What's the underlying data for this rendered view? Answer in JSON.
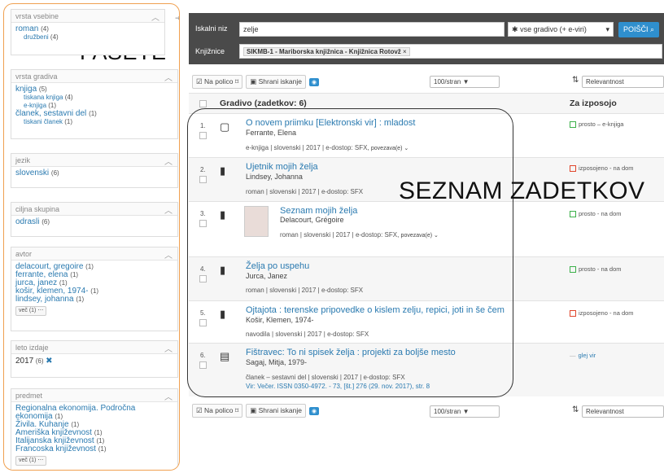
{
  "sidebar": {
    "label": "FASETE",
    "facets": [
      {
        "title": "vrsta vsebine",
        "items": [
          {
            "label": "roman",
            "count": "(4)"
          },
          {
            "label": "družbeni",
            "count": "(4)",
            "sub": true
          }
        ]
      },
      {
        "title": "vrsta gradiva",
        "items": [
          {
            "label": "knjiga",
            "count": "(5)"
          },
          {
            "label": "tiskana knjiga",
            "count": "(4)",
            "sub": true
          },
          {
            "label": "e-knjiga",
            "count": "(1)",
            "sub": true
          },
          {
            "label": "članek, sestavni del",
            "count": "(1)"
          },
          {
            "label": "tiskani članek",
            "count": "(1)",
            "sub": true
          }
        ]
      },
      {
        "title": "jezik",
        "items": [
          {
            "label": "slovenski",
            "count": "(6)"
          }
        ]
      },
      {
        "title": "ciljna skupina",
        "items": [
          {
            "label": "odrasli",
            "count": "(6)"
          }
        ]
      },
      {
        "title": "avtor",
        "items": [
          {
            "label": "delacourt, gregoire",
            "count": "(1)"
          },
          {
            "label": "ferrante, elena",
            "count": "(1)"
          },
          {
            "label": "jurca, janez",
            "count": "(1)"
          },
          {
            "label": "košir, klemen, 1974-",
            "count": "(1)"
          },
          {
            "label": "lindsey, johanna",
            "count": "(1)"
          }
        ],
        "more": "več (1) ⋯"
      },
      {
        "title": "leto izdaje",
        "items": [
          {
            "label": "2017",
            "count": "(6)"
          }
        ],
        "remove": "✖"
      },
      {
        "title": "predmet",
        "items": [
          {
            "label": "Regionalna ekonomija. Področna ekonomija",
            "count": "(1)"
          },
          {
            "label": "Živila. Kuhanje",
            "count": "(1)"
          },
          {
            "label": "Ameriška književnost",
            "count": "(1)"
          },
          {
            "label": "Italijanska književnost",
            "count": "(1)"
          },
          {
            "label": "Francoska književnost",
            "count": "(1)"
          }
        ],
        "more": "več (1) ⋯"
      }
    ]
  },
  "search": {
    "label": "Iskalni niz",
    "value": "zelje",
    "scope": "vse gradivo (+ e-viri)",
    "button": "POIŠČI",
    "lib_label": "Knjižnice",
    "lib_value": "SIKMB-1 - Mariborska knjižnica - Knjižnica Rotovž",
    "lib_remove": "×"
  },
  "toolbar": {
    "shelf": "Na policoᐸ",
    "shelf_label": "Na polico",
    "save": "Shrani iskanje",
    "perpage": "100/stran ▼",
    "sort_label": "Relevantnost"
  },
  "results": {
    "header": "Gradivo (zadetkov: 6)",
    "avail_header": "Za izposojo",
    "overlay_label": "SEZNAM ZADETKOV"
  },
  "items": [
    {
      "n": "1.",
      "title": "O novem priimku [Elektronski vir] : mladost",
      "author": "Ferrante, Elena",
      "meta": "e-knjiga | slovenski | 2017 | e-dostop: SFX,",
      "link": "povezava(e) ⌄",
      "status": "prosto – e-knjiga",
      "color": "#3cb04a"
    },
    {
      "n": "2.",
      "title": "Ujetnik mojih želja",
      "author": "Lindsey, Johanna",
      "meta": "roman | slovenski | 2017 | e-dostop: SFX",
      "status": "izposojeno - na dom",
      "color": "#e0452b"
    },
    {
      "n": "3.",
      "title": "Seznam mojih želja",
      "author": "Delacourt, Grégoire",
      "meta": "roman | slovenski | 2017 | e-dostop: SFX,",
      "link": "povezava(e) ⌄",
      "status": "prosto - na dom",
      "color": "#3cb04a"
    },
    {
      "n": "4.",
      "title": "Želja po uspehu",
      "author": "Jurca, Janez",
      "meta": "roman | slovenski | 2017 | e-dostop: SFX",
      "status": "prosto - na dom",
      "color": "#3cb04a"
    },
    {
      "n": "5.",
      "title": "Ojtajota : terenske pripovedke o kislem zelju, repici, joti in še čem",
      "author": "Košir, Klemen, 1974-",
      "meta": "navodila | slovenski | 2017 | e-dostop: SFX",
      "status": "izposojeno - na dom",
      "color": "#e0452b"
    },
    {
      "n": "6.",
      "title": "Fištravec: To ni spisek želja : projekti za boljše mesto",
      "author": "Sagaj, Mitja, 1979-",
      "meta": "članek – sestavni del | slovenski | 2017 | e-dostop: SFX",
      "meta2": "Vir: Večer. ISSN 0350-4972. - 73, [št.] 276 (29. nov. 2017), str. 8",
      "status": "glej vir",
      "color": ""
    }
  ]
}
